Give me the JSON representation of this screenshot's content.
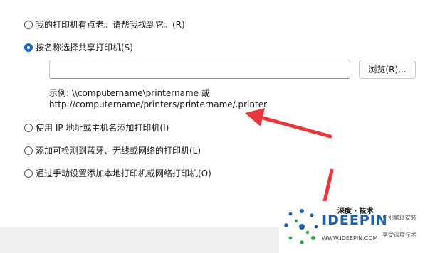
{
  "options": [
    {
      "label": "我的打印机有点老。请帮我找到它。(R)",
      "checked": false
    },
    {
      "label": "按名称选择共享打印机(S)",
      "checked": true
    },
    {
      "label": "使用 IP 地址或主机名添加打印机(I)",
      "checked": false
    },
    {
      "label": "添加可检测到蓝牙、无线或网络的打印机(L)",
      "checked": false
    },
    {
      "label": "通过手动设置添加本地打印机或网络打印机(O)",
      "checked": false
    }
  ],
  "share": {
    "input_value": "",
    "browse_label": "浏览(R)...",
    "example_line1": "示例: \\\\computername\\printername 或",
    "example_line2": "http://computername/printers/printername/.printer"
  },
  "watermark": {
    "brand_cn": "深度 · 技术",
    "brand_en": "IDEEPIN",
    "url": "WWW.IDEEPIN.COM",
    "slogan1": "告别繁琐安装",
    "slogan2": "享受深度技术"
  },
  "colors": {
    "accent": "#1b67b8",
    "arrow": "#e8383d"
  }
}
